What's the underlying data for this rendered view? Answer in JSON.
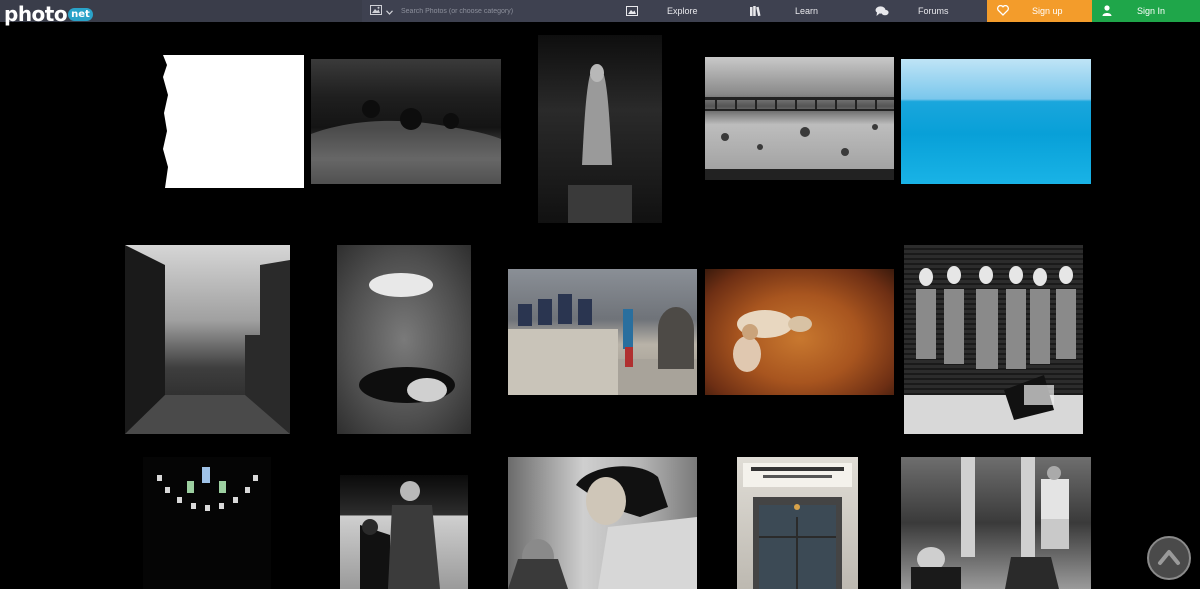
{
  "header": {
    "logo_main": "photo",
    "logo_badge": "net",
    "search_placeholder": "Search Photos (or choose category)",
    "nav": [
      {
        "label": "Explore",
        "icon": "image-icon"
      },
      {
        "label": "Learn",
        "icon": "books-icon"
      },
      {
        "label": "Forums",
        "icon": "chat-bubbles-icon"
      }
    ],
    "signup_label": "Sign up",
    "signin_label": "Sign In"
  },
  "colors": {
    "topbar": "#3a3d4a",
    "signup": "#f39c2b",
    "signin": "#1fa64a",
    "background": "#000000"
  }
}
